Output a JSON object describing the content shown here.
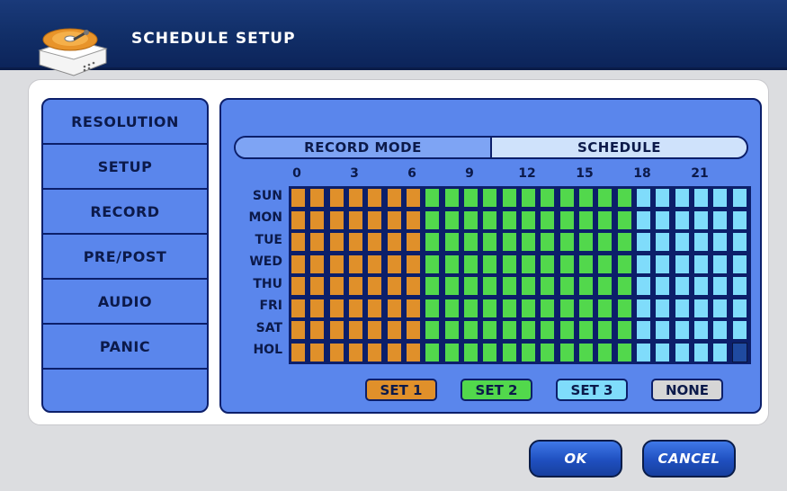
{
  "window": {
    "title": "SCHEDULE SETUP",
    "icon": "hdd-dvr-icon"
  },
  "sidebar": {
    "items": [
      {
        "label": "RESOLUTION"
      },
      {
        "label": "SETUP"
      },
      {
        "label": "RECORD"
      },
      {
        "label": "PRE/POST"
      },
      {
        "label": "AUDIO"
      },
      {
        "label": "PANIC"
      },
      {
        "label": ""
      }
    ]
  },
  "tabs": {
    "record_mode": "RECORD MODE",
    "schedule": "SCHEDULE",
    "active": "SCHEDULE"
  },
  "schedule": {
    "hour_labels": [
      "0",
      "3",
      "6",
      "9",
      "12",
      "15",
      "18",
      "21"
    ],
    "days": [
      "SUN",
      "MON",
      "TUE",
      "WED",
      "THU",
      "FRI",
      "SAT",
      "HOL"
    ],
    "rows": [
      "111111122222222222333333",
      "111111122222222222333333",
      "111111122222222222333333",
      "111111122222222222333333",
      "111111122222222222333333",
      "111111122222222222333333",
      "111111122222222222333333",
      "11111112222222222233333x"
    ],
    "selected_cell": {
      "day": "HOL",
      "hour": 23
    }
  },
  "set_buttons": [
    {
      "label": "SET 1",
      "value": "1",
      "color": "#e0902a"
    },
    {
      "label": "SET 2",
      "value": "2",
      "color": "#52d84c"
    },
    {
      "label": "SET 3",
      "value": "3",
      "color": "#7fdcfb"
    },
    {
      "label": "NONE",
      "value": "0",
      "color": "#d6d6d6"
    }
  ],
  "colors": {
    "set1": "#e0902a",
    "set2": "#52d84c",
    "set3": "#7fdcfb",
    "none": "#d6d6d6",
    "selected": "#1f4aa0",
    "panel": "#5a86ec",
    "border": "#0c1f6a"
  },
  "buttons": {
    "ok": "OK",
    "cancel": "CANCEL"
  }
}
